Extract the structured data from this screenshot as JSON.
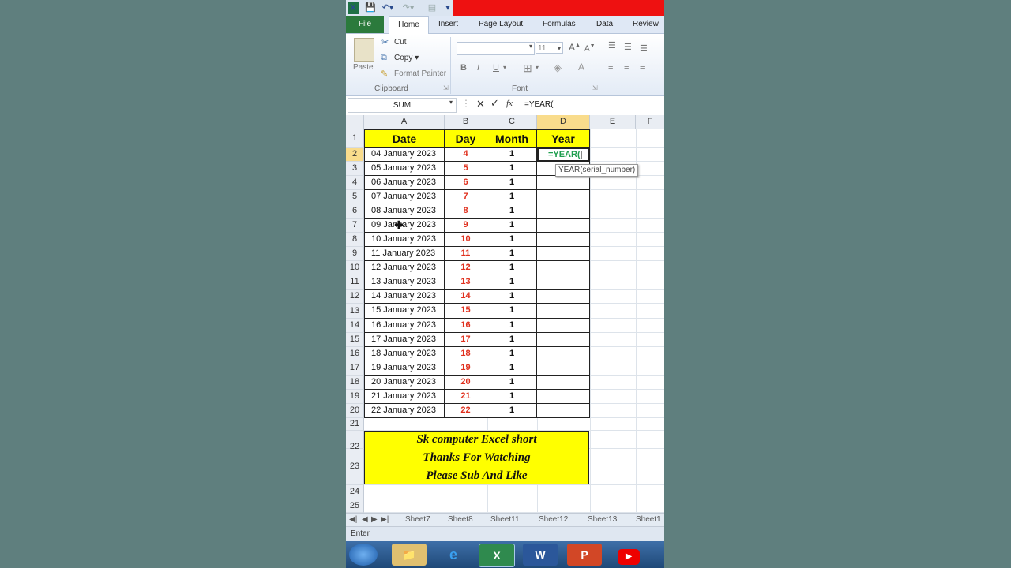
{
  "app": {
    "qat_logo": "X"
  },
  "ribbon": {
    "tabs": [
      "File",
      "Home",
      "Insert",
      "Page Layout",
      "Formulas",
      "Data",
      "Review"
    ],
    "clipboard": {
      "paste": "Paste",
      "cut": "Cut",
      "copy": "Copy",
      "format_painter": "Format Painter",
      "group": "Clipboard"
    },
    "font": {
      "size": "11",
      "bold": "B",
      "italic": "I",
      "underline": "U",
      "grow": "A",
      "group": "Font"
    }
  },
  "formula_bar": {
    "name_box": "SUM",
    "fx": "fx",
    "formula": "=YEAR("
  },
  "grid": {
    "columns": [
      "A",
      "B",
      "C",
      "D",
      "E",
      "F"
    ],
    "rows": [
      "1",
      "2",
      "3",
      "4",
      "5",
      "6",
      "7",
      "8",
      "9",
      "10",
      "11",
      "12",
      "13",
      "14",
      "15",
      "16",
      "17",
      "18",
      "19",
      "20",
      "21",
      "22",
      "23",
      "24",
      "25"
    ],
    "headers": {
      "date": "Date",
      "day": "Day",
      "month": "Month",
      "year": "Year"
    },
    "active_cell_text": "=YEAR(",
    "tooltip": "YEAR(serial_number)",
    "data": [
      {
        "date": "04 January 2023",
        "day": "4",
        "month": "1"
      },
      {
        "date": "05 January 2023",
        "day": "5",
        "month": "1"
      },
      {
        "date": "06 January 2023",
        "day": "6",
        "month": "1"
      },
      {
        "date": "07 January 2023",
        "day": "7",
        "month": "1"
      },
      {
        "date": "08 January 2023",
        "day": "8",
        "month": "1"
      },
      {
        "date": "09 January 2023",
        "day": "9",
        "month": "1"
      },
      {
        "date": "10 January 2023",
        "day": "10",
        "month": "1"
      },
      {
        "date": "11 January 2023",
        "day": "11",
        "month": "1"
      },
      {
        "date": "12 January 2023",
        "day": "12",
        "month": "1"
      },
      {
        "date": "13 January 2023",
        "day": "13",
        "month": "1"
      },
      {
        "date": "14 January 2023",
        "day": "14",
        "month": "1"
      },
      {
        "date": "15 January 2023",
        "day": "15",
        "month": "1"
      },
      {
        "date": "16 January 2023",
        "day": "16",
        "month": "1"
      },
      {
        "date": "17 January 2023",
        "day": "17",
        "month": "1"
      },
      {
        "date": "18 January 2023",
        "day": "18",
        "month": "1"
      },
      {
        "date": "19 January 2023",
        "day": "19",
        "month": "1"
      },
      {
        "date": "20 January 2023",
        "day": "20",
        "month": "1"
      },
      {
        "date": "21 January 2023",
        "day": "21",
        "month": "1"
      },
      {
        "date": "22 January 2023",
        "day": "22",
        "month": "1"
      }
    ],
    "banner": {
      "line1": "Sk computer Excel short",
      "line2": "Thanks For Watching",
      "line3": "Please Sub And Like"
    }
  },
  "sheets": [
    "Sheet7",
    "Sheet8",
    "Sheet11",
    "Sheet12",
    "Sheet13",
    "Sheet1"
  ],
  "status": "Enter",
  "colors": {
    "header_fill": "#ffff00",
    "day_text": "#e0301e",
    "excel_green": "#1e7145"
  }
}
